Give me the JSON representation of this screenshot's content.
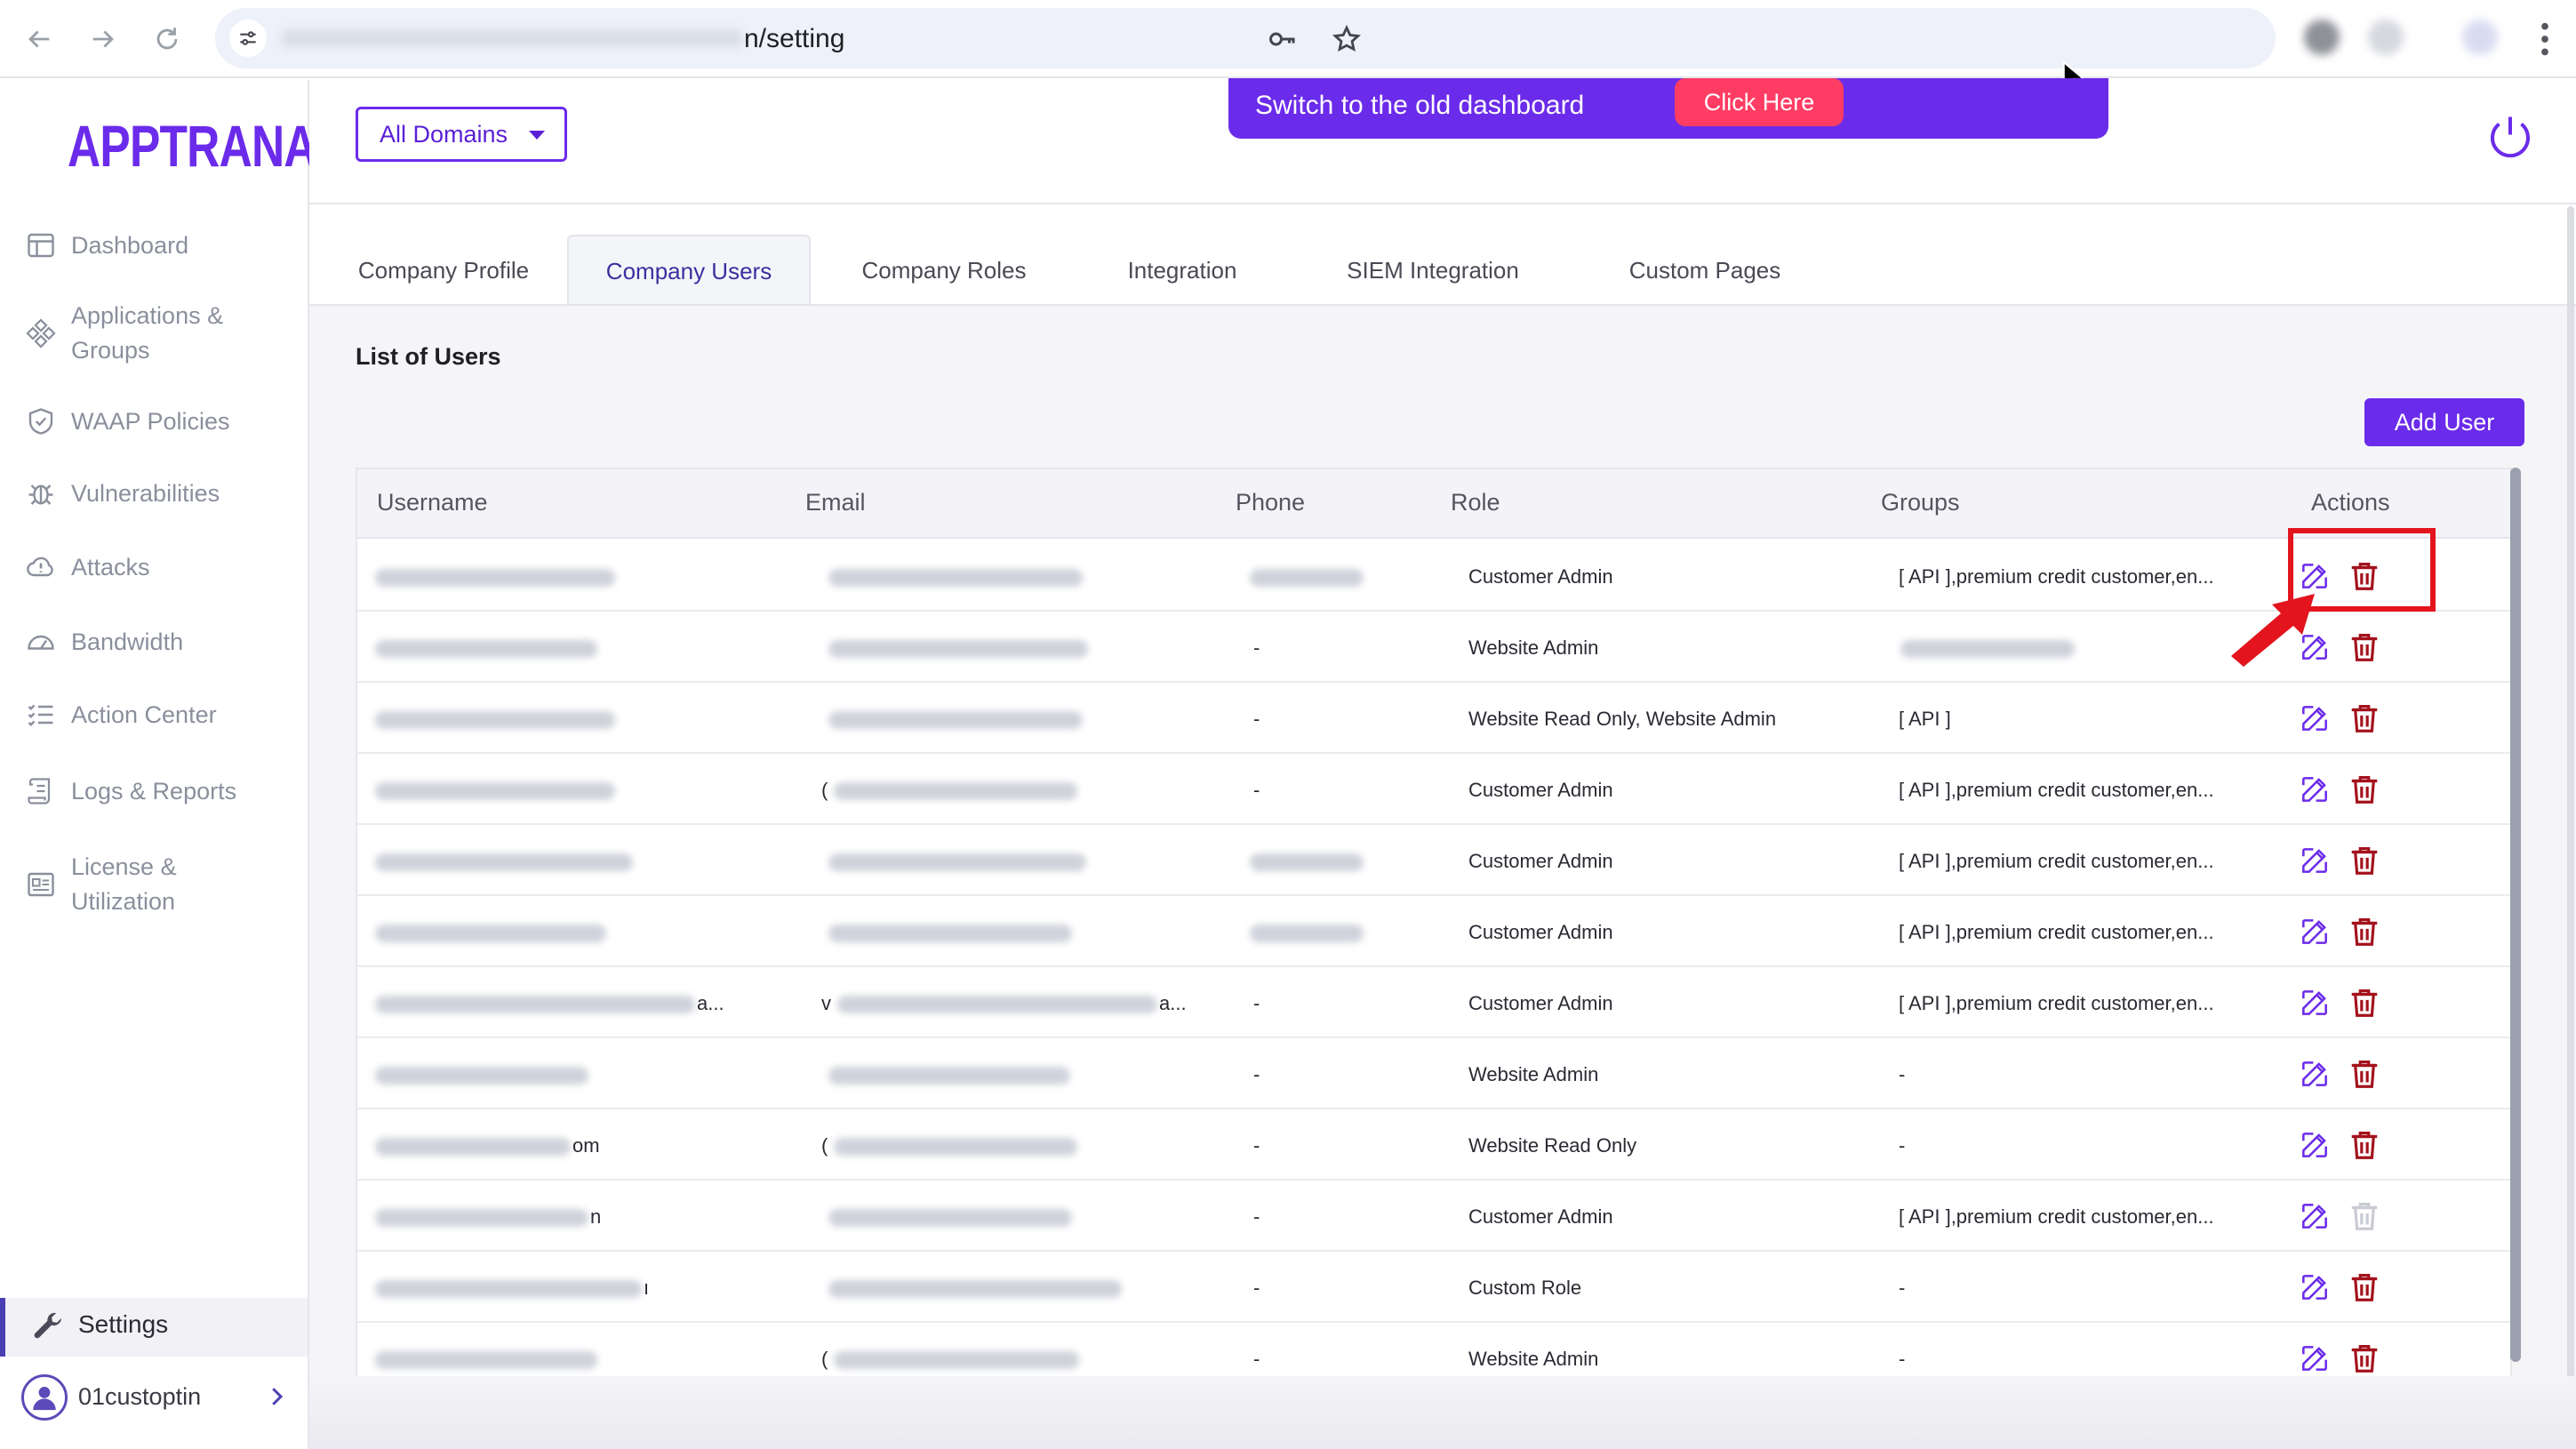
{
  "browser": {
    "url_visible_suffix": "n/setting"
  },
  "app": {
    "logo": "APPTRANA",
    "brand_color": "#6b2bea",
    "danger_color": "#a3121c"
  },
  "sidebar": {
    "items": [
      {
        "label": "Dashboard",
        "icon": "dashboard-icon"
      },
      {
        "label": "Applications &\nGroups",
        "icon": "applications-icon"
      },
      {
        "label": "WAAP Policies",
        "icon": "shield-icon"
      },
      {
        "label": "Vulnerabilities",
        "icon": "bug-icon"
      },
      {
        "label": "Attacks",
        "icon": "alert-cloud-icon"
      },
      {
        "label": "Bandwidth",
        "icon": "gauge-icon"
      },
      {
        "label": "Action Center",
        "icon": "checklist-icon"
      },
      {
        "label": "Logs & Reports",
        "icon": "scroll-icon"
      },
      {
        "label": "License &\nUtilization",
        "icon": "license-icon"
      }
    ],
    "settings_label": "Settings",
    "user_label": "01custoptin"
  },
  "header": {
    "domain_select": "All Domains",
    "banner_text": "Switch to the old dashboard",
    "banner_button": "Click Here"
  },
  "tabs": [
    {
      "label": "Company Profile",
      "active": false
    },
    {
      "label": "Company Users",
      "active": true
    },
    {
      "label": "Company Roles",
      "active": false
    },
    {
      "label": "Integration",
      "active": false
    },
    {
      "label": "SIEM Integration",
      "active": false
    },
    {
      "label": "Custom Pages",
      "active": false
    }
  ],
  "users": {
    "title": "List of Users",
    "add_button": "Add User",
    "columns": [
      "Username",
      "Email",
      "Phone",
      "Role",
      "Groups",
      "Actions"
    ],
    "rows": [
      {
        "username_suffix": "",
        "email_prefix": "",
        "email_suffix": "",
        "phone": "",
        "role": "Customer Admin",
        "groups": "[ API ],premium credit customer,en...",
        "delete_enabled": true
      },
      {
        "username_suffix": "",
        "email_prefix": "",
        "email_suffix": "",
        "phone": "-",
        "role": "Website Admin",
        "groups": "",
        "delete_enabled": true
      },
      {
        "username_suffix": "",
        "email_prefix": "",
        "email_suffix": "",
        "phone": "-",
        "role": "Website Read Only, Website Admin",
        "groups": "[ API ]",
        "delete_enabled": true
      },
      {
        "username_suffix": "",
        "email_prefix": "(",
        "email_suffix": "",
        "phone": "-",
        "role": "Customer Admin",
        "groups": "[ API ],premium credit customer,en...",
        "delete_enabled": true
      },
      {
        "username_suffix": "",
        "email_prefix": "",
        "email_suffix": "",
        "phone": "",
        "role": "Customer Admin",
        "groups": "[ API ],premium credit customer,en...",
        "delete_enabled": true
      },
      {
        "username_suffix": "",
        "email_prefix": "",
        "email_suffix": "",
        "phone": "",
        "role": "Customer Admin",
        "groups": "[ API ],premium credit customer,en...",
        "delete_enabled": true
      },
      {
        "username_suffix": "a...",
        "email_prefix": "v",
        "email_suffix": "a...",
        "phone": "-",
        "role": "Customer Admin",
        "groups": "[ API ],premium credit customer,en...",
        "delete_enabled": true
      },
      {
        "username_suffix": "",
        "email_prefix": "",
        "email_suffix": "",
        "phone": "-",
        "role": "Website Admin",
        "groups": "-",
        "delete_enabled": true
      },
      {
        "username_suffix": "om",
        "email_prefix": "(",
        "email_suffix": "",
        "phone": "-",
        "role": "Website Read Only",
        "groups": "-",
        "delete_enabled": true
      },
      {
        "username_suffix": "n",
        "email_prefix": "",
        "email_suffix": "",
        "phone": "-",
        "role": "Customer Admin",
        "groups": "[ API ],premium credit customer,en...",
        "delete_enabled": false
      },
      {
        "username_suffix": "ı",
        "email_prefix": "",
        "email_suffix": "",
        "phone": "-",
        "role": "Custom Role",
        "groups": "-",
        "delete_enabled": true
      },
      {
        "username_suffix": "",
        "email_prefix": "(",
        "email_suffix": "",
        "phone": "-",
        "role": "Website Admin",
        "groups": "-",
        "delete_enabled": true
      }
    ]
  }
}
